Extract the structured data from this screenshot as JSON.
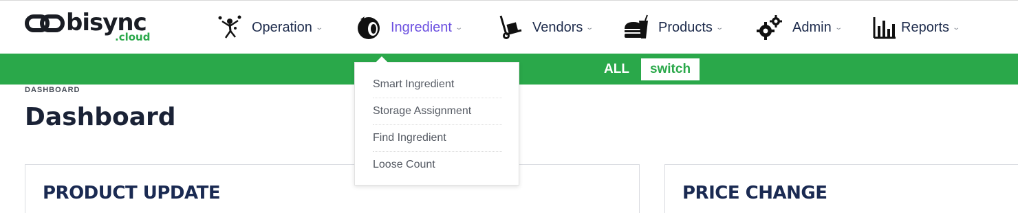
{
  "brand": {
    "name": "bisync",
    "sub": ".cloud"
  },
  "nav": {
    "items": [
      {
        "label": "Operation",
        "icon": "juggler-icon",
        "active": false
      },
      {
        "label": "Ingredient",
        "icon": "coconut-icon",
        "active": true
      },
      {
        "label": "Vendors",
        "icon": "hand-truck-icon",
        "active": false
      },
      {
        "label": "Products",
        "icon": "burger-drink-icon",
        "active": false
      },
      {
        "label": "Admin",
        "icon": "gears-icon",
        "active": false
      },
      {
        "label": "Reports",
        "icon": "bar-chart-icon",
        "active": false
      }
    ]
  },
  "filter": {
    "all_label": "ALL",
    "switch_label": "switch"
  },
  "breadcrumb": "DASHBOARD",
  "page_title": "Dashboard",
  "cards": [
    {
      "title": "PRODUCT UPDATE"
    },
    {
      "title": "PRICE CHANGE"
    }
  ],
  "dropdown": {
    "items": [
      {
        "label": "Smart Ingredient"
      },
      {
        "label": "Storage Assignment"
      },
      {
        "label": "Find Ingredient"
      },
      {
        "label": "Loose Count"
      }
    ]
  },
  "colors": {
    "accent_green": "#2aa84a",
    "active_purple": "#6b4fe0",
    "navy_text": "#1c2a4b"
  }
}
